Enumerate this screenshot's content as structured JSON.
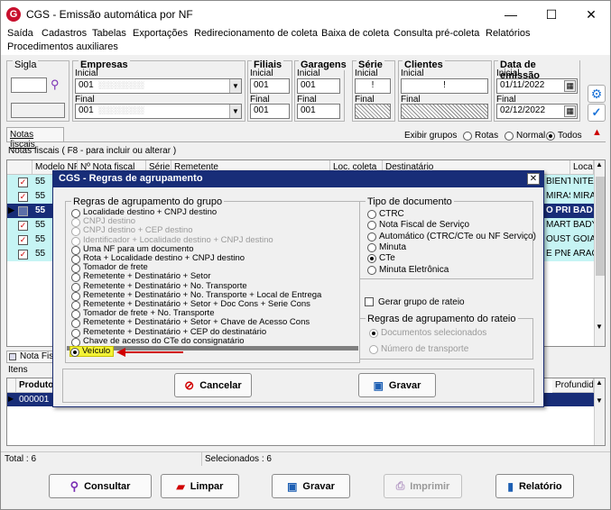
{
  "window": {
    "title": "CGS - Emissão automática por NF",
    "logo": "G"
  },
  "menu": [
    "Saída",
    "Cadastros",
    "Tabelas",
    "Exportações",
    "Redirecionamento de coleta",
    "Baixa de coleta",
    "Consulta pré-coleta",
    "Relatórios",
    "Procedimentos auxiliares"
  ],
  "filters": {
    "sigla_label": "Sigla",
    "empresas_label": "Empresas",
    "inicial_label": "Inicial",
    "final_label": "Final",
    "empresa_inicial": "001",
    "empresa_final": "001",
    "filiais_label": "Filiais",
    "filial_inicial": "001",
    "filial_final": "001",
    "garagens_label": "Garagens",
    "garagem_inicial": "001",
    "garagem_final": "001",
    "serie_label": "Série",
    "serie_inicial": "!",
    "clientes_label": "Clientes",
    "cliente_inicial": "!",
    "data_label": "Data de emissão",
    "data_inicial": "01/11/2022",
    "data_final": "02/12/2022"
  },
  "tabs": {
    "notas_fiscais": "Notas fiscais"
  },
  "grid_caption": "Notas fiscais ( F8 - para incluir ou alterar )",
  "exibir": {
    "label": "Exibir grupos",
    "rotas": "Rotas",
    "normal": "Normal",
    "todos": "Todos"
  },
  "grid": {
    "headers": [
      "Modelo NF",
      "Nº Nota fiscal",
      "Série",
      "Remetente",
      "Loc. coleta",
      "Destinatário",
      "Loca"
    ],
    "rows": [
      {
        "modelo": "55",
        "right": "BIENT",
        "loc": "NITE"
      },
      {
        "modelo": "55",
        "right": "MIRAS",
        "loc": "MIRA"
      },
      {
        "modelo": "55",
        "right": "O PRI",
        "loc": "BAD"
      },
      {
        "modelo": "55",
        "right": "MARTI",
        "loc": "BADY"
      },
      {
        "modelo": "55",
        "right": "OUSTF",
        "loc": "GOIA"
      },
      {
        "modelo": "55",
        "right": "E PNE",
        "loc": "ARAC"
      }
    ]
  },
  "nota_fiscal_tab": "Nota Fis",
  "itens": {
    "label": "Itens",
    "col_produto": "Produto",
    "col_profundidade": "Profundid",
    "row": "000001"
  },
  "status": {
    "total": "Total : 6",
    "selecionados": "Selecionados : 6"
  },
  "buttons": {
    "consultar": "Consultar",
    "limpar": "Limpar",
    "gravar": "Gravar",
    "imprimir": "Imprimir",
    "relatorio": "Relatório"
  },
  "dialog": {
    "title": "CGS - Regras de agrupamento",
    "group_title": "Regras de agrupamento do grupo",
    "options": [
      {
        "label": "Localidade destino + CNPJ destino",
        "state": "normal"
      },
      {
        "label": "CNPJ destino",
        "state": "disabled"
      },
      {
        "label": "CNPJ destino + CEP destino",
        "state": "disabled"
      },
      {
        "label": "Identificador + Localidade destino + CNPJ destino",
        "state": "disabled"
      },
      {
        "label": "Uma NF para um documento",
        "state": "normal"
      },
      {
        "label": "Rota + Localidade destino + CNPJ destino",
        "state": "normal"
      },
      {
        "label": "Tomador de frete",
        "state": "normal"
      },
      {
        "label": "Remetente + Destinatário + Setor",
        "state": "normal"
      },
      {
        "label": "Remetente + Destinatário + No. Transporte",
        "state": "normal"
      },
      {
        "label": "Remetente + Destinatário + No. Transporte + Local de Entrega",
        "state": "normal"
      },
      {
        "label": "Remetente + Destinatário + Setor + Doc Cons + Serie Cons",
        "state": "normal"
      },
      {
        "label": "Tomador de frete + No. Transporte",
        "state": "normal"
      },
      {
        "label": "Remetente + Destinatário + Setor + Chave de Acesso Cons",
        "state": "normal"
      },
      {
        "label": "Remetente + Destinatário + CEP do destinatário",
        "state": "normal"
      },
      {
        "label": "Chave de acesso do CTe do consignatário",
        "state": "normal"
      },
      {
        "label": "Veículo",
        "state": "selected"
      }
    ],
    "tipo_title": "Tipo de documento",
    "tipo_options": [
      {
        "label": "CTRC",
        "selected": false
      },
      {
        "label": "Nota Fiscal de Serviço",
        "selected": false
      },
      {
        "label": "Automático (CTRC/CTe ou NF Serviço)",
        "selected": false
      },
      {
        "label": "Minuta",
        "selected": false
      },
      {
        "label": "CTe",
        "selected": true
      },
      {
        "label": "Minuta Eletrônica",
        "selected": false
      }
    ],
    "rateio_check": "Gerar grupo de rateio",
    "rateio_title": "Regras de agrupamento do rateio",
    "rateio_options": [
      "Documentos selecionados",
      "Número de transporte"
    ],
    "cancel": "Cancelar",
    "save": "Gravar"
  },
  "colors": {
    "accent": "#182d78",
    "row_green": "#c6f4f4",
    "highlight": "#f3f335",
    "arrow": "#d10000"
  }
}
